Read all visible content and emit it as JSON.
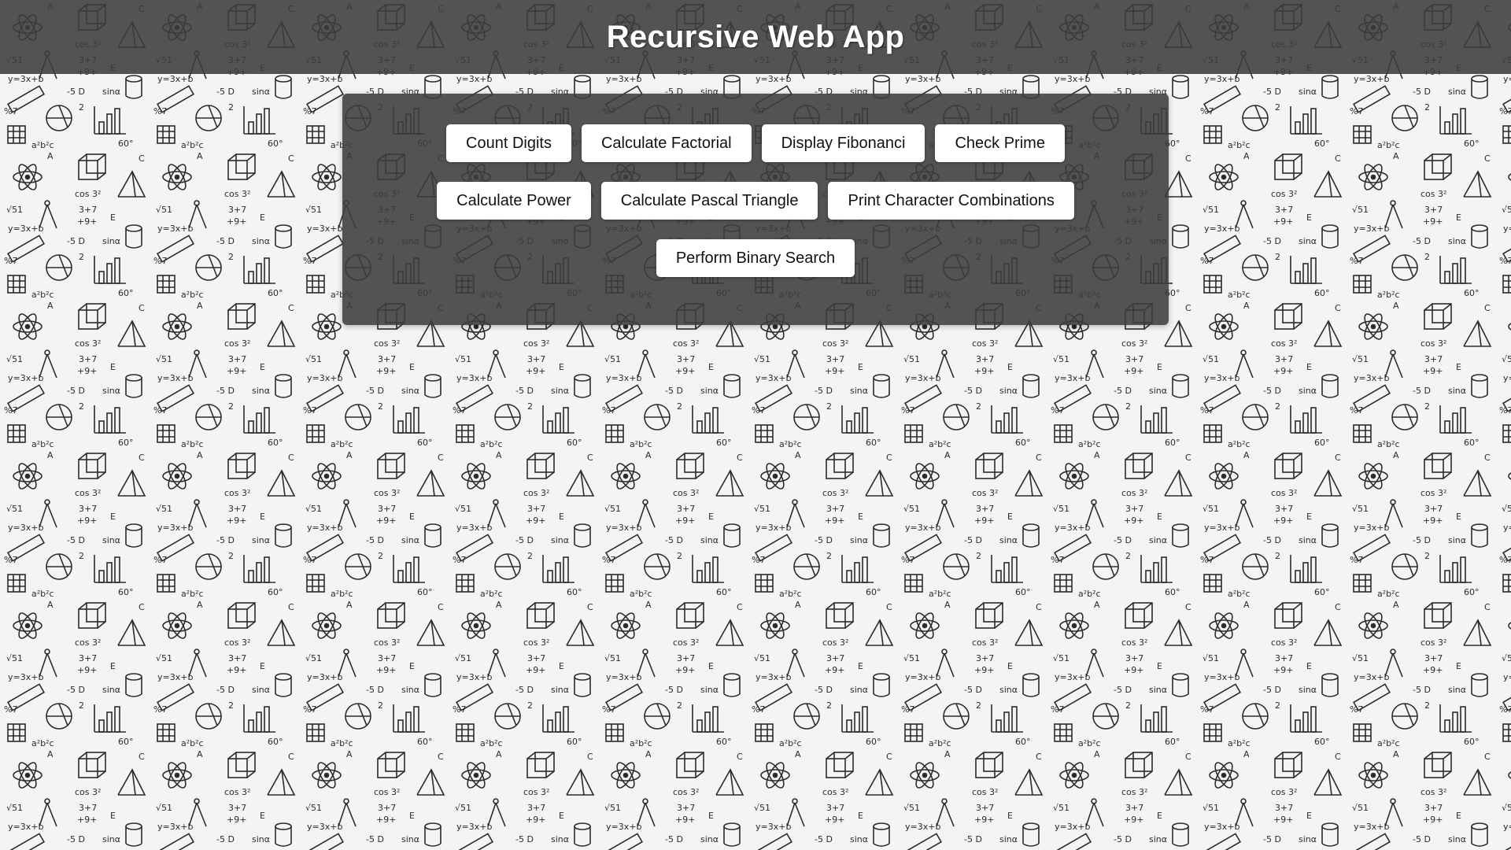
{
  "header": {
    "title": "Recursive Web App"
  },
  "buttons": {
    "count_digits": "Count Digits",
    "calculate_factorial": "Calculate Factorial",
    "display_fibonacci": "Display Fibonanci",
    "check_prime": "Check Prime",
    "calculate_power": "Calculate Power",
    "calculate_pascal_triangle": "Calculate Pascal Triangle",
    "print_character_combinations": "Print Character Combinations",
    "perform_binary_search": "Perform Binary Search"
  },
  "colors": {
    "header_background": "#3c3c3c",
    "panel_background": "#3c3c3c",
    "button_background": "#ffffff",
    "title_text": "#ffffff"
  },
  "background": {
    "pattern": "math-doodle-pattern"
  }
}
